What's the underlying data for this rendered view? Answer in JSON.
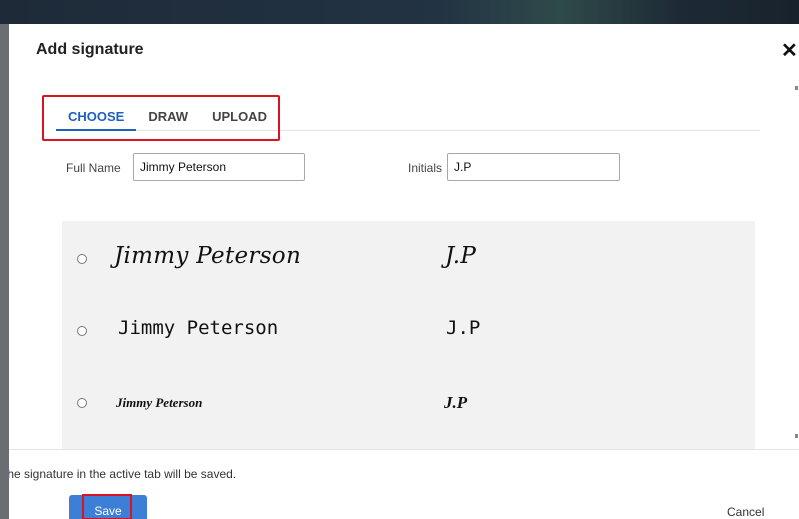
{
  "dialog": {
    "title": "Add signature",
    "close_icon": "close-icon"
  },
  "tabs": [
    {
      "label": "CHOOSE",
      "active": true
    },
    {
      "label": "DRAW",
      "active": false
    },
    {
      "label": "UPLOAD",
      "active": false
    }
  ],
  "form": {
    "full_name_label": "Full Name",
    "full_name_value": "Jimmy Peterson",
    "initials_label": "Initials",
    "initials_value": "J.P"
  },
  "signature_options": [
    {
      "name": "Jimmy Peterson",
      "initials": "J.P",
      "style": "script"
    },
    {
      "name": "Jimmy Peterson",
      "initials": "J.P",
      "style": "monospace"
    },
    {
      "name": "Jimmy Peterson",
      "initials": "J.P",
      "style": "calligraphy"
    }
  ],
  "footer": {
    "note": "The signature in the active tab will be saved.",
    "save_label": "Save",
    "cancel_label": "Cancel"
  },
  "colors": {
    "accent": "#3d7fd6",
    "active_tab": "#1f5fbf",
    "highlight": "#d9131f",
    "panel": "#f2f2f2"
  }
}
